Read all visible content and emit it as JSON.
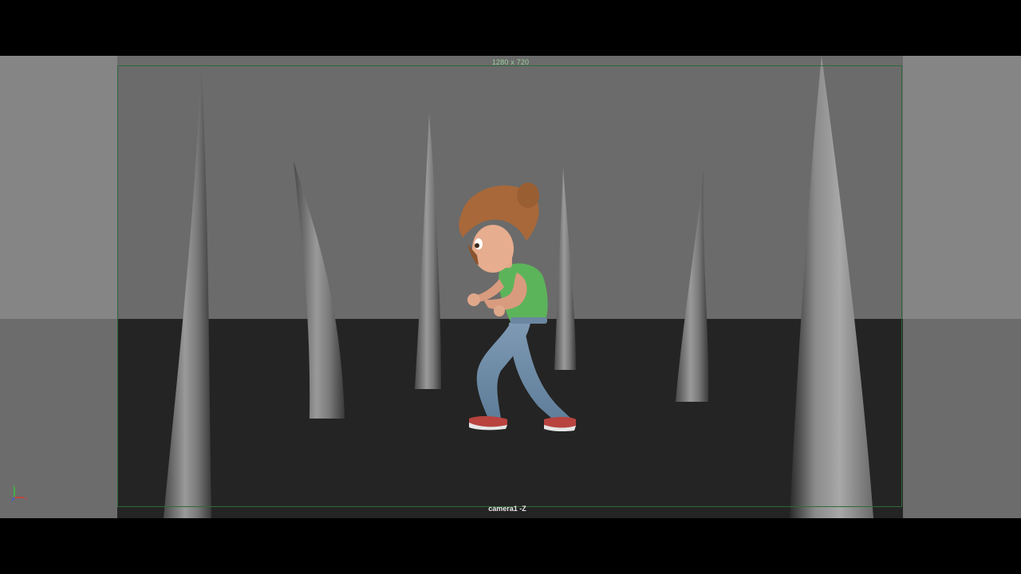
{
  "viewport": {
    "resolution_label": "1280 x 720",
    "camera_label": "camera1 -Z"
  },
  "axis_gizmo": {
    "y_label": "y",
    "x_label": "x",
    "colors": {
      "y": "#3fbf3f",
      "x": "#d43a3a",
      "z": "#3a5fd4"
    }
  },
  "colors": {
    "background_wall": "#6b6b6b",
    "floor": "#242424",
    "gate_border": "#2e6a3a"
  }
}
